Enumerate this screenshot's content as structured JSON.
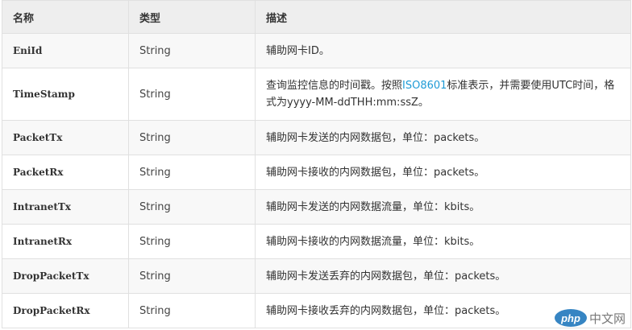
{
  "table": {
    "headers": {
      "name": "名称",
      "type": "类型",
      "desc": "描述"
    },
    "rows": [
      {
        "name": "EniId",
        "type": "String",
        "desc": "辅助网卡ID。"
      },
      {
        "name": "TimeStamp",
        "type": "String",
        "desc_part1": "查询监控信息的时间戳。按照",
        "desc_link": "ISO8601",
        "desc_part2": "标准表示，并需要使用UTC时间，格式为yyyy-MM-ddTHH:mm:ssZ。"
      },
      {
        "name": "PacketTx",
        "type": "String",
        "desc": "辅助网卡发送的内网数据包，单位：packets。"
      },
      {
        "name": "PacketRx",
        "type": "String",
        "desc": "辅助网卡接收的内网数据包，单位：packets。"
      },
      {
        "name": "IntranetTx",
        "type": "String",
        "desc": "辅助网卡发送的内网数据流量，单位：kbits。"
      },
      {
        "name": "IntranetRx",
        "type": "String",
        "desc": "辅助网卡接收的内网数据流量，单位：kbits。"
      },
      {
        "name": "DropPacketTx",
        "type": "String",
        "desc": "辅助网卡发送丢弃的内网数据包，单位：packets。"
      },
      {
        "name": "DropPacketRx",
        "type": "String",
        "desc": "辅助网卡接收丢弃的内网数据包，单位：packets。"
      }
    ]
  },
  "watermark": {
    "logo": "php",
    "text": "中文网"
  },
  "colors": {
    "header_bg": "#eeeeee",
    "link": "#1f9bd6",
    "border": "#e0e0e0",
    "row_alt": "#f8f8f8"
  }
}
